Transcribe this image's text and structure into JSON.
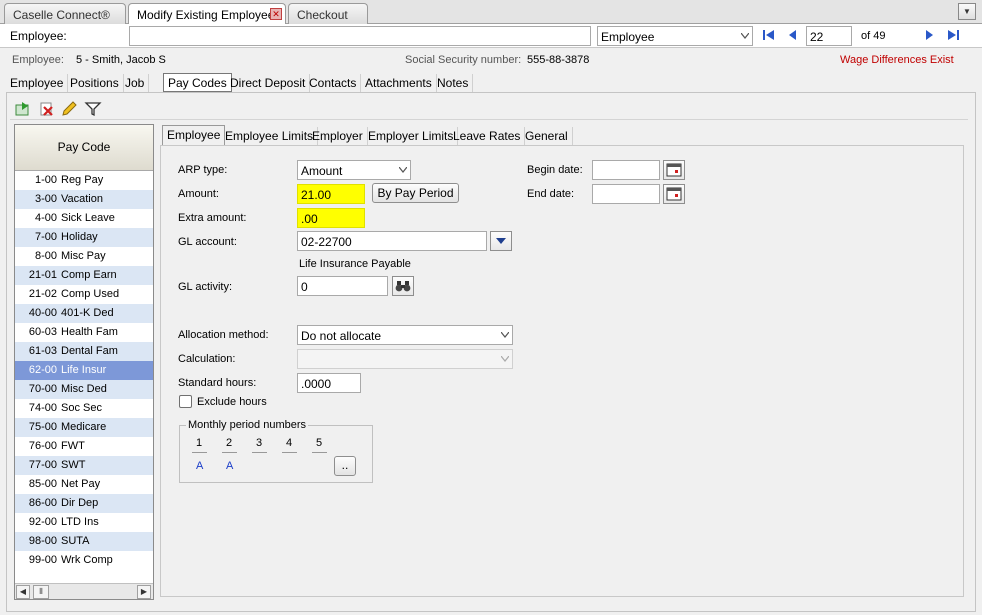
{
  "app_tabs": [
    {
      "label": "Caselle Connect®"
    },
    {
      "label": "Modify Existing Employees"
    },
    {
      "label": "Checkout"
    }
  ],
  "search": {
    "label": "Employee:",
    "value": "",
    "mode_value": "Employee",
    "record_number": "22",
    "of_label": "of 49"
  },
  "info": {
    "employee_label": "Employee:",
    "employee_value": "5 - Smith, Jacob S",
    "ssn_label": "Social Security number:",
    "ssn_value": "555-88-3878",
    "warning": "Wage Differences Exist"
  },
  "section_tabs": [
    "Employee",
    "Positions",
    "Job",
    "Pay Codes",
    "Direct Deposit",
    "Contacts",
    "Attachments",
    "Notes"
  ],
  "pay_code_list": {
    "header": "Pay Code",
    "items": [
      {
        "code": "1-00",
        "name": "Reg Pay"
      },
      {
        "code": "3-00",
        "name": "Vacation"
      },
      {
        "code": "4-00",
        "name": "Sick Leave"
      },
      {
        "code": "7-00",
        "name": "Holiday"
      },
      {
        "code": "8-00",
        "name": "Misc Pay"
      },
      {
        "code": "21-01",
        "name": "Comp Earn"
      },
      {
        "code": "21-02",
        "name": "Comp Used"
      },
      {
        "code": "40-00",
        "name": "401-K Ded"
      },
      {
        "code": "60-03",
        "name": "Health Fam"
      },
      {
        "code": "61-03",
        "name": "Dental Fam"
      },
      {
        "code": "62-00",
        "name": "Life Insur"
      },
      {
        "code": "70-00",
        "name": "Misc Ded"
      },
      {
        "code": "74-00",
        "name": "Soc Sec"
      },
      {
        "code": "75-00",
        "name": "Medicare"
      },
      {
        "code": "76-00",
        "name": "FWT"
      },
      {
        "code": "77-00",
        "name": "SWT"
      },
      {
        "code": "85-00",
        "name": "Net Pay"
      },
      {
        "code": "86-00",
        "name": "Dir Dep"
      },
      {
        "code": "92-00",
        "name": "LTD Ins"
      },
      {
        "code": "98-00",
        "name": "SUTA"
      },
      {
        "code": "99-00",
        "name": "Wrk Comp"
      }
    ]
  },
  "detail_tabs": [
    "Employee",
    "Employee Limits",
    "Employer",
    "Employer Limits",
    "Leave Rates",
    "General"
  ],
  "form": {
    "arp_type_label": "ARP type:",
    "arp_type_value": "Amount",
    "amount_label": "Amount:",
    "amount_value": "21.00",
    "by_pay_period_label": "By Pay Period",
    "extra_amount_label": "Extra amount:",
    "extra_amount_value": ".00",
    "gl_account_label": "GL account:",
    "gl_account_value": "02-22700",
    "gl_account_desc": "Life Insurance Payable",
    "gl_activity_label": "GL activity:",
    "gl_activity_value": "0",
    "begin_date_label": "Begin date:",
    "begin_date_value": "",
    "end_date_label": "End date:",
    "end_date_value": "",
    "allocation_label": "Allocation method:",
    "allocation_value": "Do not allocate",
    "calculation_label": "Calculation:",
    "calculation_value": "",
    "standard_hours_label": "Standard hours:",
    "standard_hours_value": ".0000",
    "exclude_hours_label": "Exclude hours",
    "monthly_label": "Monthly period numbers",
    "periods": [
      {
        "num": "1",
        "val": "A"
      },
      {
        "num": "2",
        "val": "A"
      },
      {
        "num": "3",
        "val": ""
      },
      {
        "num": "4",
        "val": ""
      },
      {
        "num": "5",
        "val": ""
      }
    ],
    "more_label": ".."
  },
  "colors": {
    "highlight": "#ffff00",
    "selected_row": "#7d98d8",
    "alt_row": "#dbe6f4",
    "warning": "#c00000"
  },
  "icons": [
    "new-record-icon",
    "delete-icon",
    "edit-pencil-icon",
    "filter-icon",
    "first-record-icon",
    "prev-record-icon",
    "next-record-icon",
    "last-record-icon",
    "calendar-icon",
    "binoculars-icon",
    "dropdown-arrow-icon"
  ]
}
